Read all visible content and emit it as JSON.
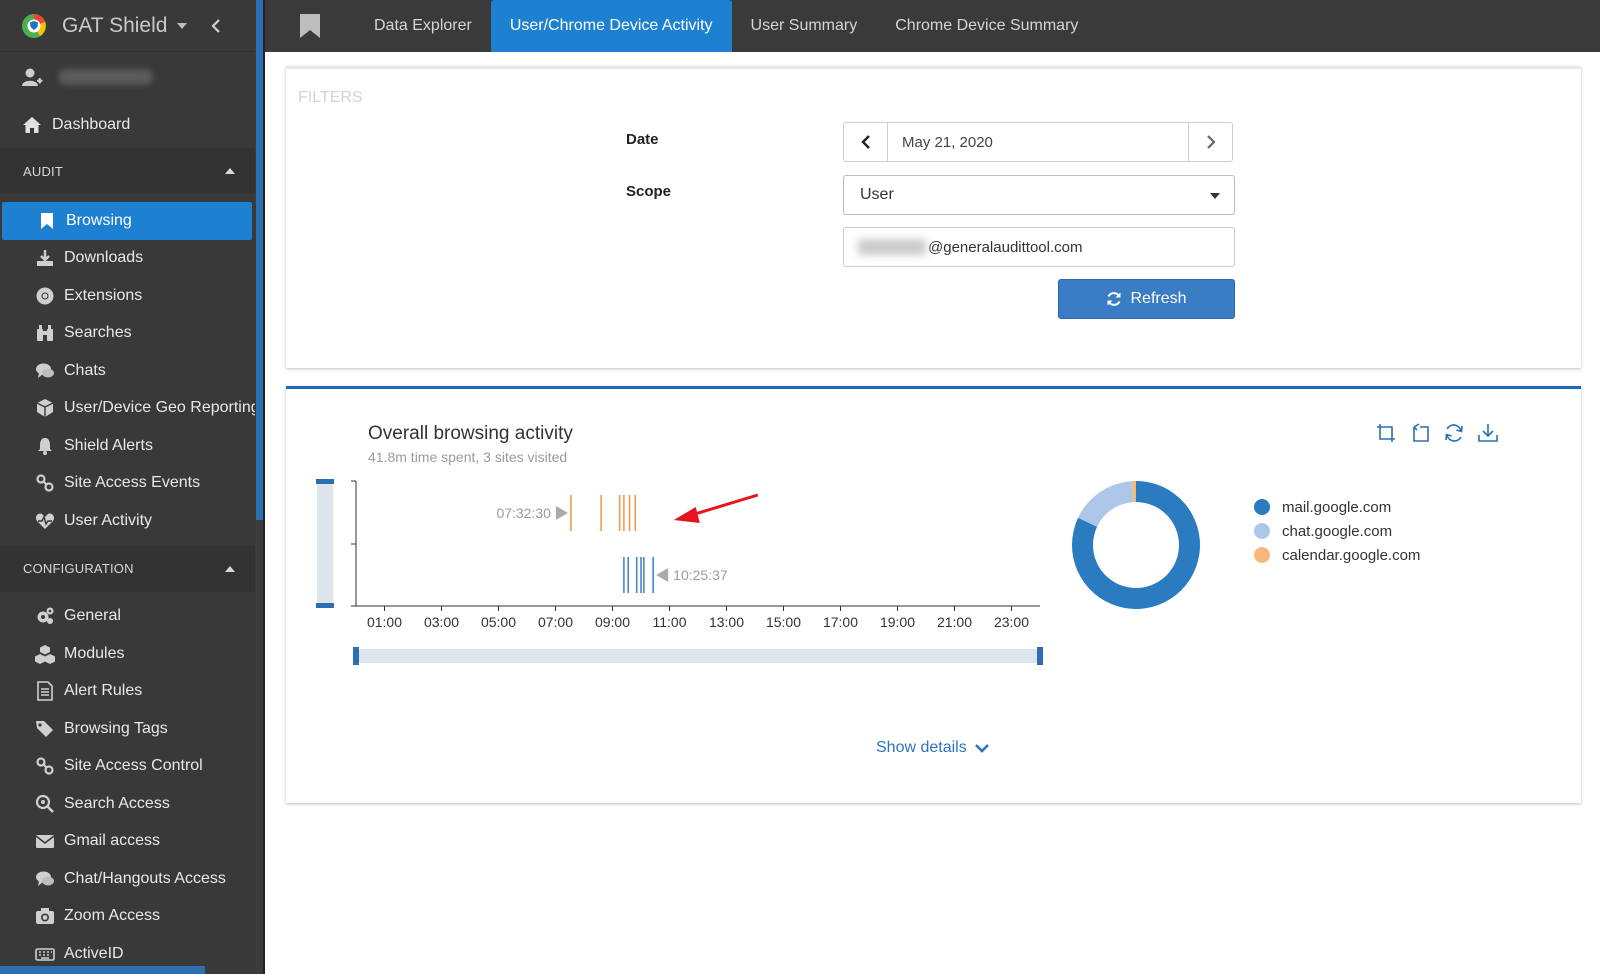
{
  "app": {
    "name": "GAT Shield"
  },
  "sidebar": {
    "dashboard": {
      "label": "Dashboard"
    },
    "audit_title": "AUDIT",
    "audit_items": [
      {
        "label": "Browsing",
        "icon": "bookmark-icon"
      },
      {
        "label": "Downloads",
        "icon": "download-icon"
      },
      {
        "label": "Extensions",
        "icon": "chrome-icon"
      },
      {
        "label": "Searches",
        "icon": "binoculars-icon"
      },
      {
        "label": "Chats",
        "icon": "chat-icon"
      },
      {
        "label": "User/Device Geo Reporting",
        "icon": "cube-icon"
      },
      {
        "label": "Shield Alerts",
        "icon": "bell-icon"
      },
      {
        "label": "Site Access Events",
        "icon": "link-icon"
      },
      {
        "label": "User Activity",
        "icon": "heartbeat-icon"
      }
    ],
    "config_title": "CONFIGURATION",
    "config_items": [
      {
        "label": "General",
        "icon": "gears-icon"
      },
      {
        "label": "Modules",
        "icon": "cubes-icon"
      },
      {
        "label": "Alert Rules",
        "icon": "document-icon"
      },
      {
        "label": "Browsing Tags",
        "icon": "tags-icon"
      },
      {
        "label": "Site Access Control",
        "icon": "link-icon"
      },
      {
        "label": "Search Access",
        "icon": "search-gear-icon"
      },
      {
        "label": "Gmail access",
        "icon": "envelope-icon"
      },
      {
        "label": "Chat/Hangouts Access",
        "icon": "chat-icon"
      },
      {
        "label": "Zoom Access",
        "icon": "camera-icon"
      },
      {
        "label": "ActiveID",
        "icon": "keyboard-icon"
      }
    ]
  },
  "topbar": {
    "tabs": [
      {
        "label": "Data Explorer"
      },
      {
        "label": "User/Chrome Device Activity"
      },
      {
        "label": "User Summary"
      },
      {
        "label": "Chrome Device Summary"
      }
    ]
  },
  "filters": {
    "title": "FILTERS",
    "date_label": "Date",
    "date_value": "May 21, 2020",
    "scope_label": "Scope",
    "scope_value": "User",
    "email_value": "@generalaudittool.com",
    "refresh_label": "Refresh"
  },
  "activity": {
    "title": "Overall browsing activity",
    "subtitle": "41.8m time spent, 3 sites visited",
    "show_details": "Show details",
    "label_start": "07:32:30",
    "label_end": "10:25:37"
  },
  "colors": {
    "accent": "#1e80d0",
    "mail": "#2a7bbf",
    "chat": "#aec7e8",
    "calendar": "#f7b97b",
    "arrow": "#e8141b"
  },
  "chart_data": {
    "type": "timeline",
    "x_ticks": [
      "01:00",
      "03:00",
      "05:00",
      "07:00",
      "09:00",
      "11:00",
      "13:00",
      "15:00",
      "17:00",
      "19:00",
      "21:00",
      "23:00"
    ],
    "x_range_hours": [
      0,
      24
    ],
    "rows": [
      {
        "name": "calendar.google.com",
        "color": "#f29a4f",
        "times_hours": [
          7.542,
          8.6,
          9.25,
          9.4,
          9.6,
          9.8
        ]
      },
      {
        "name": "mail.google.com",
        "color": "#4a87c4",
        "times_hours": [
          9.4,
          9.55,
          9.85,
          10.0,
          10.1,
          10.427
        ]
      }
    ],
    "donut": [
      {
        "name": "mail.google.com",
        "value": 82,
        "color": "#2a7bbf"
      },
      {
        "name": "chat.google.com",
        "value": 17,
        "color": "#aec7e8"
      },
      {
        "name": "calendar.google.com",
        "value": 1,
        "color": "#f7b97b"
      }
    ]
  }
}
